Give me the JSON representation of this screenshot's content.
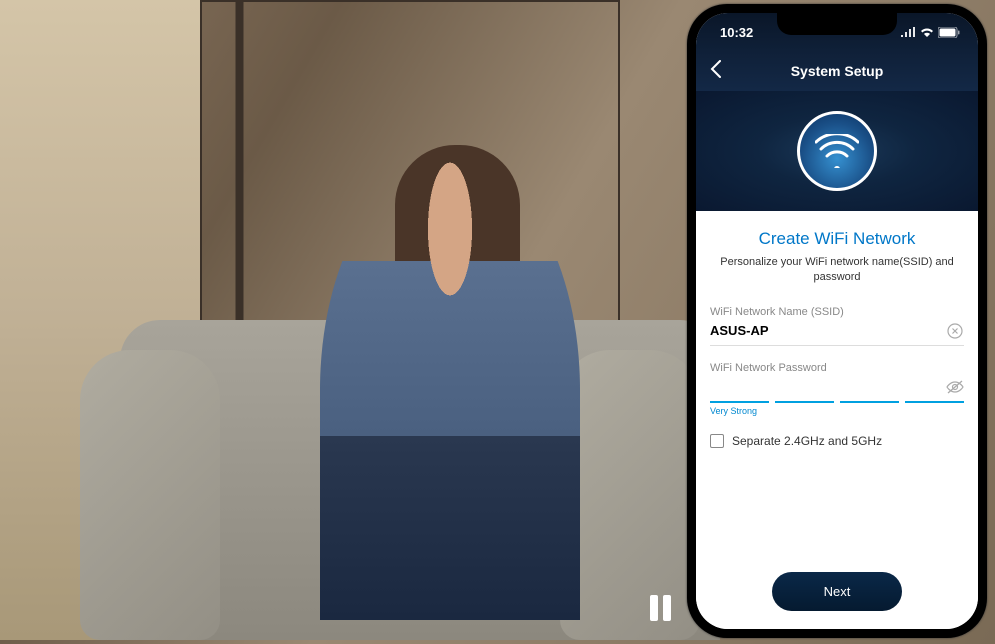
{
  "statusbar": {
    "time": "10:32"
  },
  "header": {
    "title": "System Setup"
  },
  "form": {
    "title": "Create WiFi Network",
    "subtitle": "Personalize your WiFi network name(SSID) and password",
    "ssid_label": "WiFi Network Name (SSID)",
    "ssid_value": "ASUS-AP",
    "password_label": "WiFi Network Password",
    "password_value": "",
    "strength_text": "Very Strong",
    "separate_bands_label": "Separate 2.4GHz and 5GHz"
  },
  "buttons": {
    "next": "Next"
  }
}
